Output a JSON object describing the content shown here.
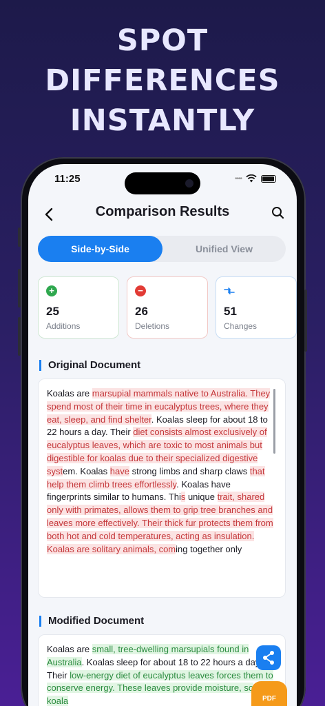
{
  "promo": {
    "line1": "SPOT",
    "line2": "DIFFERENCES",
    "line3": "INSTANTLY"
  },
  "status": {
    "time": "11:25"
  },
  "nav": {
    "title": "Comparison Results"
  },
  "tabs": {
    "side_by_side": "Side-by-Side",
    "unified": "Unified View"
  },
  "stats": {
    "additions": {
      "count": "25",
      "label": "Additions"
    },
    "deletions": {
      "count": "26",
      "label": "Deletions"
    },
    "changes": {
      "count": "51",
      "label": "Changes"
    }
  },
  "original": {
    "title": "Original Document",
    "segments": [
      {
        "t": "Koalas are ",
        "h": ""
      },
      {
        "t": "marsupial mammals native to Australia. They spend most of their time in eucalyptus trees, where they eat, sleep, and find shelter",
        "h": "del"
      },
      {
        "t": ". Koalas sleep for about ",
        "h": ""
      },
      {
        "t": "18 to 22",
        "h": ""
      },
      {
        "t": " hours a day. Their ",
        "h": ""
      },
      {
        "t": "diet consists almost exclusively of eucalyptus leaves, which are toxic to most animals but digestible for koalas due to their specialized digestive syst",
        "h": "del"
      },
      {
        "t": "em.",
        "h": ""
      },
      {
        "t": " Koalas ",
        "h": ""
      },
      {
        "t": "have",
        "h": "del"
      },
      {
        "t": " strong limbs and sharp claws ",
        "h": ""
      },
      {
        "t": "that help them climb trees effortlessly",
        "h": "del"
      },
      {
        "t": ". Koalas have fingerprints similar to humans. Thi",
        "h": ""
      },
      {
        "t": "s",
        "h": "del"
      },
      {
        "t": " unique ",
        "h": ""
      },
      {
        "t": "trait, shared only with primates, allows them to grip tree branches and leaves more effectively. Their thick fur protects them from both hot and cold temperatures, acting as insulation. Koalas are solitary animals, com",
        "h": "del"
      },
      {
        "t": "ing toge",
        "h": ""
      },
      {
        "t": "ther only",
        "h": ""
      }
    ]
  },
  "modified": {
    "title": "Modified Document",
    "segments": [
      {
        "t": "Koalas are ",
        "h": ""
      },
      {
        "t": "small, tree-dwelling marsupials found in Australia",
        "h": "add"
      },
      {
        "t": ". Koalas sleep for about 18 to 22 hours a day. Their ",
        "h": ""
      },
      {
        "t": "low-energy diet of eucalyptus leaves forces them to conserve energy. These leaves provide moisture, so koala",
        "h": "add"
      }
    ]
  },
  "fab": {
    "pdf": "PDF"
  },
  "colors": {
    "accent": "#1a7ff0",
    "addition": "#2fa84f",
    "deletion": "#e23b35",
    "pdf": "#f59a1a"
  }
}
